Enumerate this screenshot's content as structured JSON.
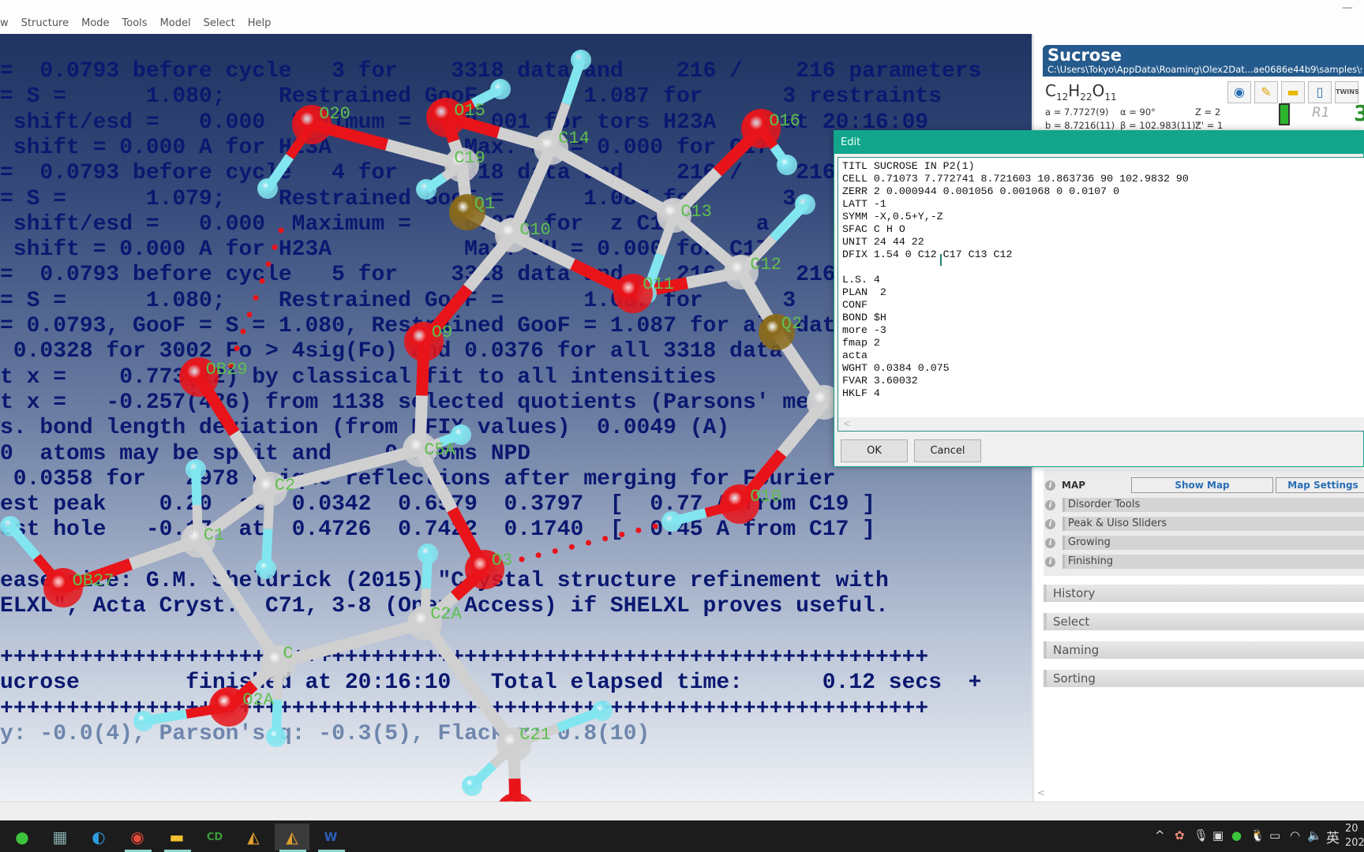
{
  "menu": [
    "w",
    "Structure",
    "Mode",
    "Tools",
    "Model",
    "Select",
    "Help"
  ],
  "console": {
    "lines": [
      "=  0.0793 before cycle   3 for    3318 data and    216 /    216 parameters",
      "= S =      1.080;    Restrained GooF =      1.087 for      3 restraints",
      " shift/esd =   0.000  Maximum =    0.001 for tors H23A     at 20:16:09",
      " shift = 0.000 A for H23A          Max. dU = 0.000 for C17",
      "=  0.0793 before cycle   4 for    3318 data and    216 /    216",
      "= S =      1.079;    Restrained GooF =      1.087 for      3",
      " shift/esd =   0.000  Maximum =    0.001 for  z C17      a",
      " shift = 0.000 A for H23A          Max. dU = 0.000 for C17",
      "=  0.0793 before cycle   5 for    3318 data and    216 /    216",
      "= S =      1.080;    Restrained GooF =      1.087 for      3",
      "= 0.0793, GooF = S = 1.080, Restrained GooF = 1.087 for all data",
      " 0.0328 for 3002 Fo > 4sig(Fo) and 0.0376 for all 3318 data",
      "t x =    0.773(12) by classical fit to all intensities",
      "t x =   -0.257(426) from 1138 selected quotients (Parsons' me",
      "s. bond length deviation (from DFIX values)  0.0049 (A)",
      "0  atoms may be split and    0 atoms NPD",
      " 0.0358 for   2978 unique reflections after merging for Fourier",
      "est peak    0.20  at  0.0342  0.6579  0.3797  [  0.77 A from C19 ]",
      "est hole   -0.17  at  0.4726  0.7422  0.1740  [  0.45 A from C17 ]",
      "",
      "ease cite: G.M. Sheldrick (2015) \"Crystal structure refinement with",
      "ELXL\", Acta Cryst., C71, 3-8 (Open Access) if SHELXL proves useful.",
      "",
      "++++++++++++++++++++++++++++++++++++++++++++++++++++++++++++++++++++++",
      "ucrose        finished at 20:16:10   Total elapsed time:      0.12 secs  +",
      "++++++++++++++++++++++++++++++++++++++++++++++++++++++++++++++++++++++",
      "y: -0.0(4), Parson's q: -0.3(5), Flack x: 0.8(10)"
    ]
  },
  "molecule": {
    "atom_labels": [
      "O20",
      "O15",
      "C14",
      "C19",
      "Q1",
      "C10",
      "O16",
      "C13",
      "C12",
      "O11",
      "Q2",
      "O9",
      "C5A",
      "OB29",
      "C2",
      "C1",
      "OB27",
      "O3",
      "C2A",
      "C",
      "O2A",
      "C21",
      "O10"
    ],
    "colors": {
      "carbon": "#d0d0d0",
      "oxygen": "#e8141a",
      "hydrogen": "#82e6f0",
      "peak": "#8a6a1a",
      "label": "#5fbf4f"
    }
  },
  "panel": {
    "title": "Sucrose",
    "path": "C:\\Users\\Tokyo\\AppData\\Roaming\\Olex2Dat...ae0686e44b9\\samples\\sucrose\\",
    "formula": {
      "c": "C",
      "c_n": "12",
      "h": "H",
      "h_n": "22",
      "o": "O",
      "o_n": "11"
    },
    "twins_label": "TWINS",
    "cell": {
      "a": "a = 7.7727(9)",
      "alpha": "α = 90°",
      "z": "Z = 2",
      "b": "b = 8.7216(11)",
      "beta": "β = 102.983(11)°",
      "zprime": "Z' = 1"
    },
    "r1_label": "R1",
    "r1_value": "3",
    "map_label": "MAP",
    "show_map": "Show Map",
    "map_settings": "Map Settings",
    "tools": [
      "Disorder Tools",
      "Peak & Uiso Sliders",
      "Growing",
      "Finishing"
    ],
    "sections": [
      "History",
      "Select",
      "Naming",
      "Sorting"
    ],
    "brand_color": "#245a8c"
  },
  "dialog": {
    "title": "Edit",
    "lines": [
      "TITL SUCROSE IN P2(1)",
      "CELL 0.71073 7.772741 8.721603 10.863736 90 102.9832 90",
      "ZERR 2 0.000944 0.001056 0.001068 0 0.0107 0",
      "LATT -1",
      "SYMM -X,0.5+Y,-Z",
      "SFAC C H O",
      "UNIT 24 44 22",
      "DFIX 1.54 0 C12 C17 C13 C12",
      "",
      "L.S. 4",
      "PLAN  2",
      "CONF",
      "BOND $H",
      "more -3",
      "fmap 2",
      "acta",
      "WGHT 0.0384 0.075",
      "FVAR 3.60032",
      "HKLF 4"
    ],
    "ok": "OK",
    "cancel": "Cancel",
    "accent": "#11a68c"
  },
  "taskbar": {
    "apps": [
      "wechat-icon",
      "calculator-icon",
      "edge-icon",
      "chrome-icon",
      "file-explorer-icon",
      "chemdraw-icon",
      "olex2-icon",
      "olex2-icon-active",
      "word-icon"
    ],
    "tray_ime": "英",
    "clock_time": "20",
    "clock_date": "202"
  }
}
